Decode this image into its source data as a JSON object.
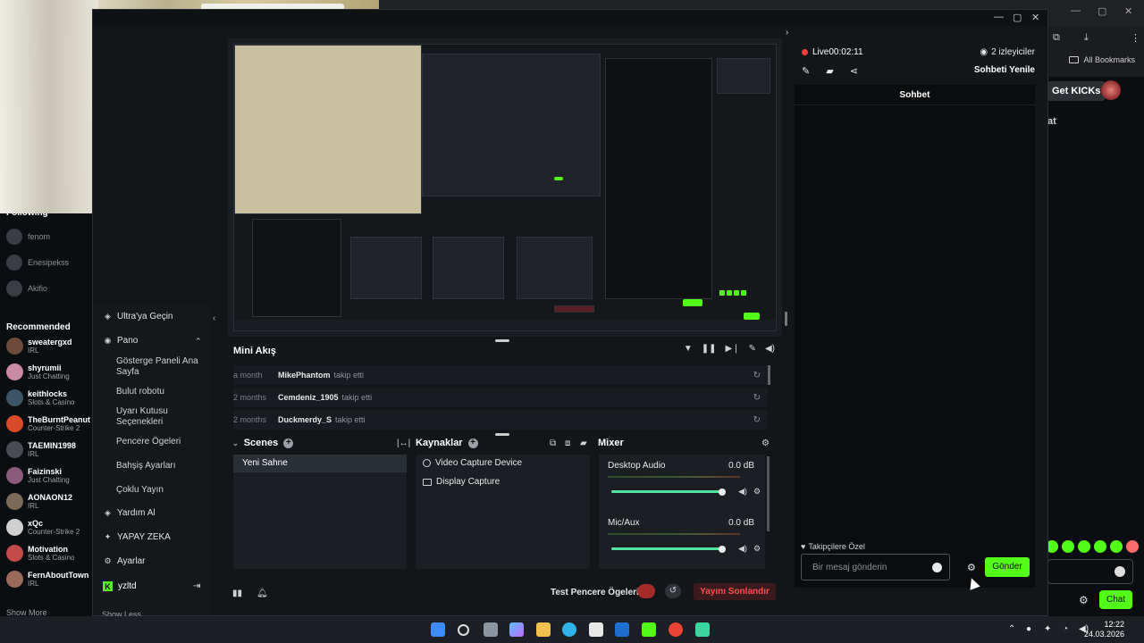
{
  "browser": {
    "bookmarks_label": "All Bookmarks",
    "get_kicks_label": "Get KICKs",
    "chat_label": "Chat",
    "partial_text": "at"
  },
  "kick_sidebar": {
    "following_title": "Following",
    "following": [
      {
        "name": "fenom"
      },
      {
        "name": "Enesipekss"
      },
      {
        "name": "Akifio"
      }
    ],
    "recommended_title": "Recommended",
    "recommended": [
      {
        "name": "sweatergxd",
        "category": "IRL",
        "color": "#6b4a3a"
      },
      {
        "name": "shyrumii",
        "category": "Just Chatting",
        "color": "#c98aa4"
      },
      {
        "name": "keithlocks",
        "category": "Slots & Casino",
        "color": "#3b5566"
      },
      {
        "name": "TheBurntPeanut",
        "category": "Counter-Strike 2",
        "color": "#d84a2a"
      },
      {
        "name": "TAEMIN1998",
        "category": "IRL",
        "color": "#4a4a52"
      },
      {
        "name": "Faizinski",
        "category": "Just Chatting",
        "color": "#8a5a7a"
      },
      {
        "name": "AONAON12",
        "category": "IRL",
        "color": "#7a6a5a"
      },
      {
        "name": "xQc",
        "category": "Counter-Strike 2",
        "color": "#d0d0d0"
      },
      {
        "name": "Motivation",
        "category": "Slots & Casino",
        "color": "#c24a4a"
      },
      {
        "name": "FernAboutTown",
        "category": "IRL",
        "color": "#9a6a5a"
      }
    ],
    "show_more": "Show More"
  },
  "nav": {
    "upgrade": "Ultra'ya Geçin",
    "dashboard": "Pano",
    "sub_items": [
      "Gösterge Paneli Ana Sayfa",
      "Bulut robotu",
      "Uyarı Kutusu Seçenekleri",
      "Pencere Ögeleri",
      "Bahşiş Ayarları",
      "Çoklu Yayın"
    ],
    "help": "Yardım Al",
    "ai": "YAPAY ZEKA",
    "settings": "Ayarlar",
    "username": "yzltd",
    "show_less": "Show Less"
  },
  "mini_feed": {
    "title": "Mini Akış",
    "rows": [
      {
        "time": "a month",
        "user": "MikePhantom",
        "action": "takip etti"
      },
      {
        "time": "2 months",
        "user": "Cemdeniz_1905",
        "action": "takip etti"
      },
      {
        "time": "2 months",
        "user": "Duckmerdy_S",
        "action": "takip etti"
      }
    ]
  },
  "scenes": {
    "title": "Scenes",
    "items": [
      "Yeni Sahne"
    ]
  },
  "sources": {
    "title": "Kaynaklar",
    "items": [
      "Video Capture Device",
      "Display Capture"
    ]
  },
  "mixer": {
    "title": "Mixer",
    "channels": [
      {
        "name": "Desktop Audio",
        "db": "0.0 dB",
        "level": 1.0
      },
      {
        "name": "Mic/Aux",
        "db": "0.0 dB",
        "level": 1.0
      }
    ]
  },
  "bottom": {
    "test_label": "Test Pencere Ögeleri",
    "end_stream": "Yayını Sonlandır"
  },
  "chat": {
    "live_label": "Live",
    "live_time": "00:02:11",
    "viewers": "2 izleyiciler",
    "refresh": "Sohbeti Yenile",
    "header": "Sohbet",
    "followers_only": "Takipçilere Özel",
    "input_placeholder": "Bir mesaj gönderin",
    "send": "Gönder"
  },
  "taskbar": {
    "time": "12:22",
    "date": "24.03.2026"
  },
  "colors": {
    "accent": "#53fc18",
    "danger": "#ff4d4f",
    "live": "#ff3b3b"
  }
}
